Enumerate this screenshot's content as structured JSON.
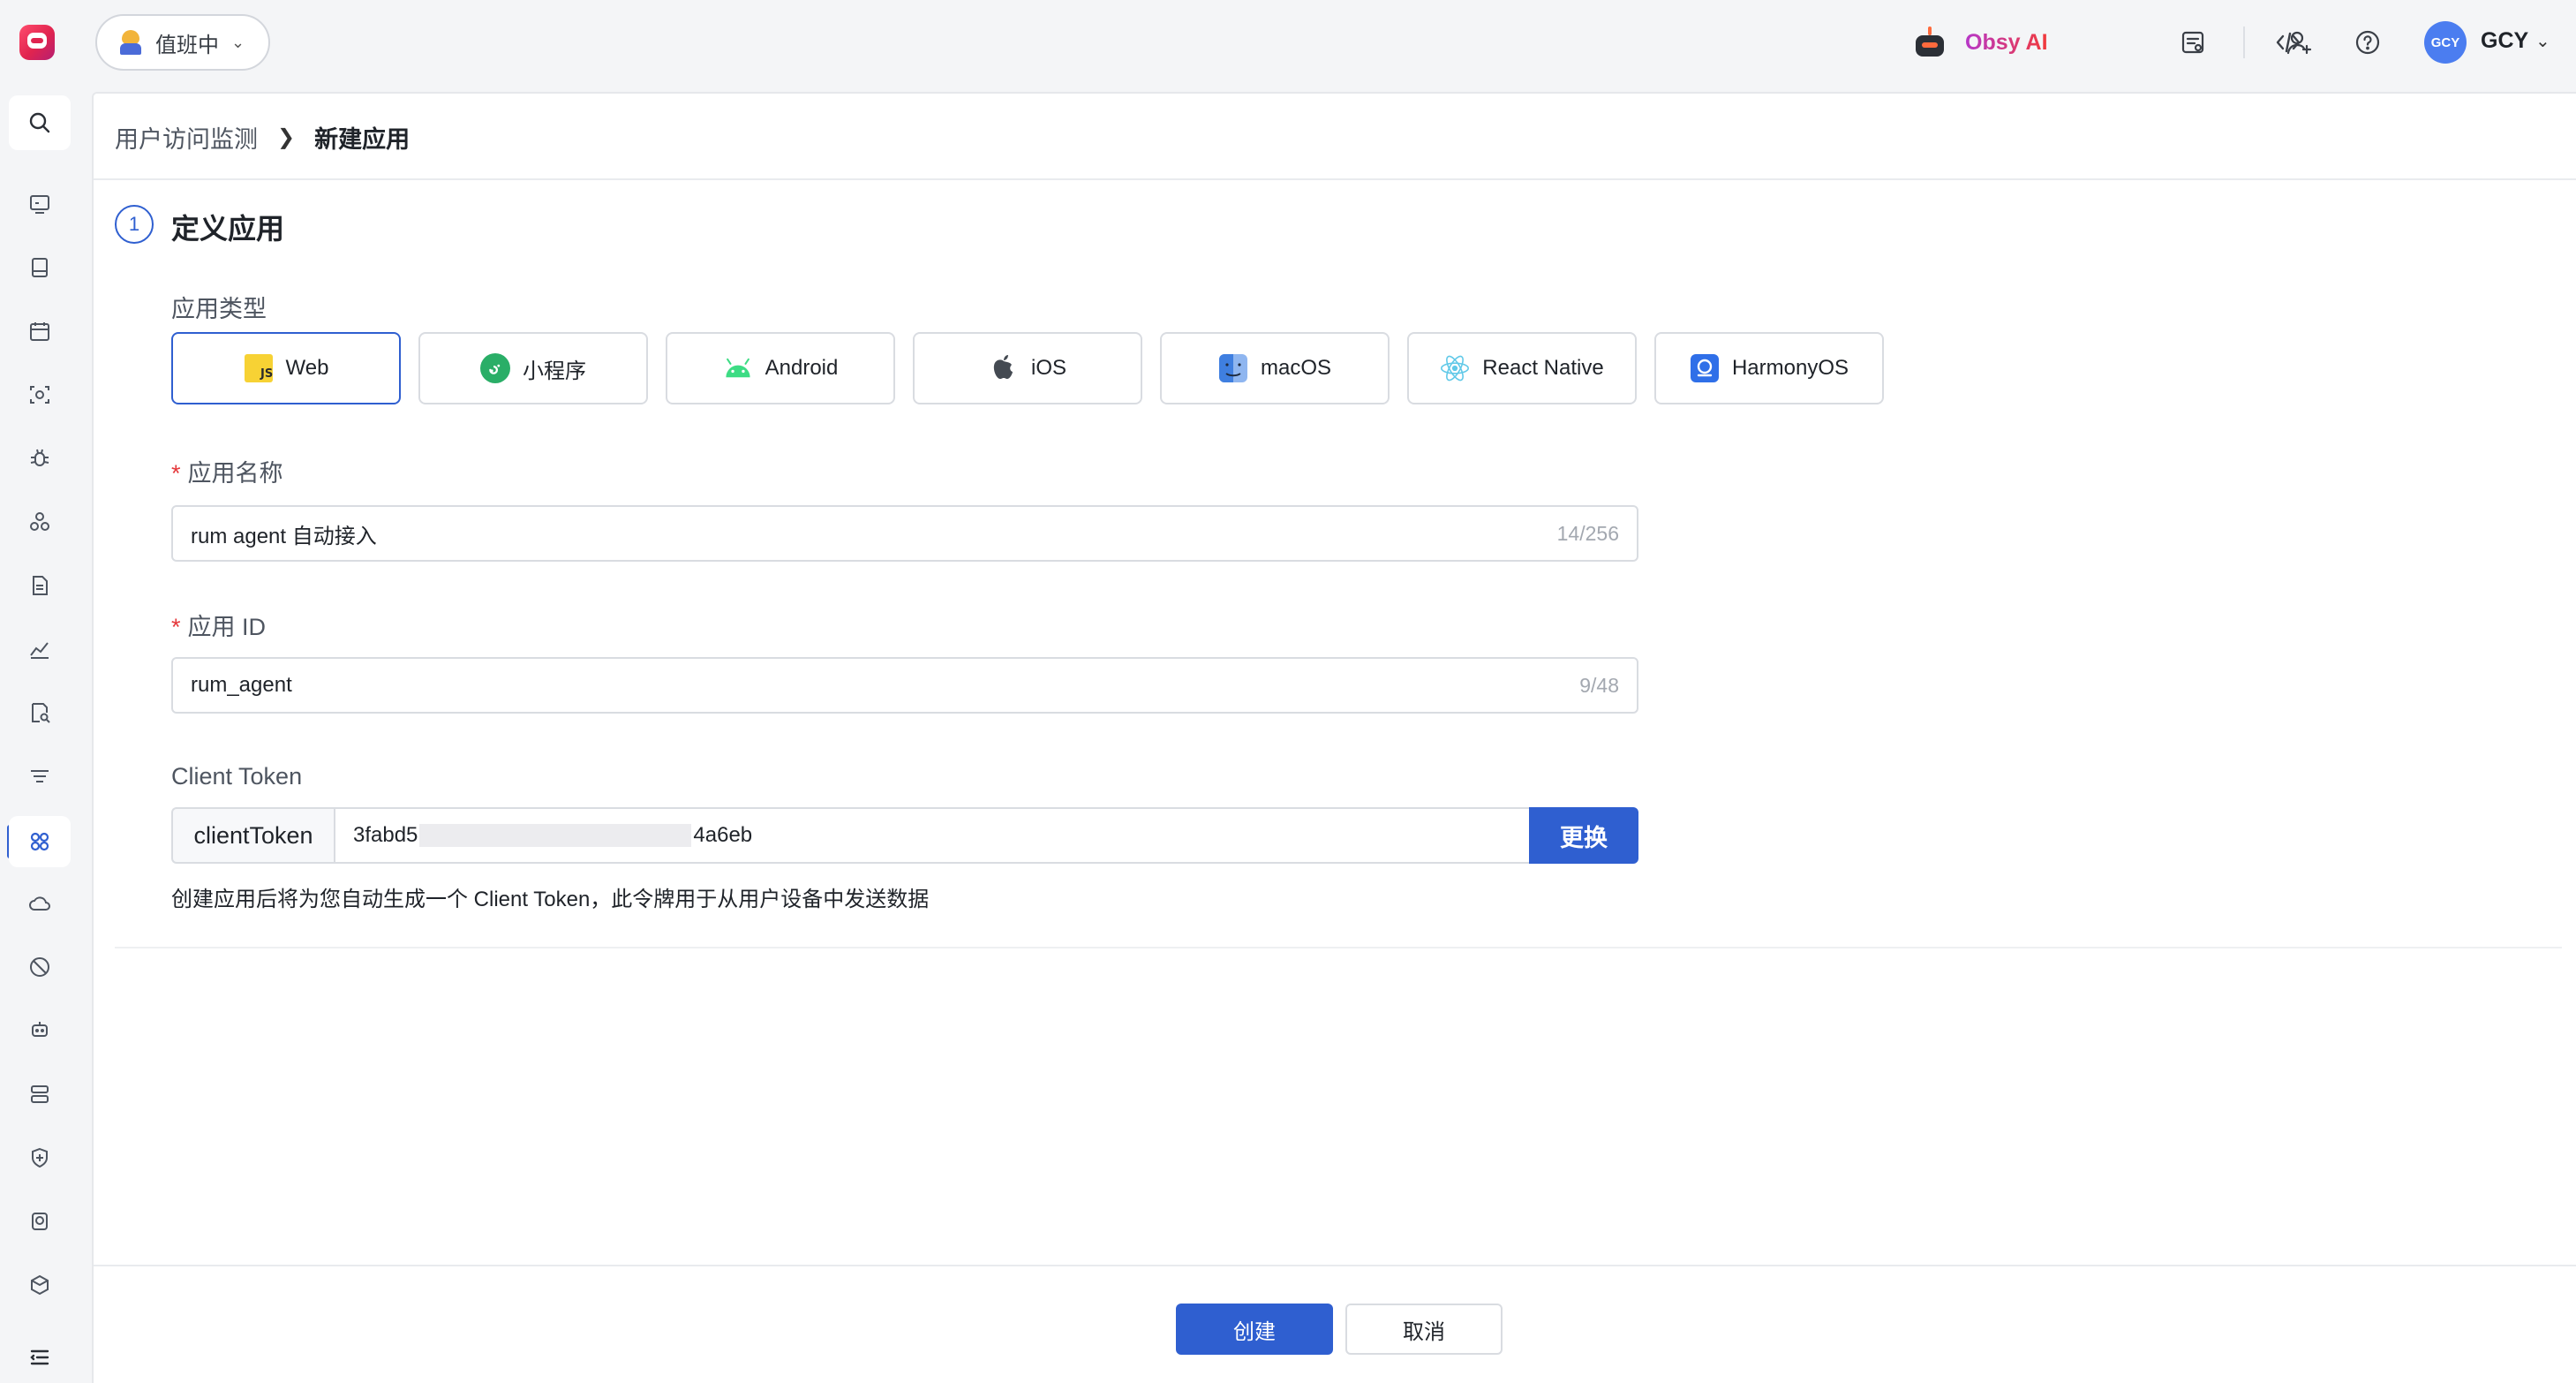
{
  "topbar": {
    "duty_status": "值班中",
    "ai_label": "Obsy AI",
    "user_initials": "GCY",
    "user_name": "GCY"
  },
  "breadcrumb": {
    "parent": "用户访问监测",
    "current": "新建应用"
  },
  "step": {
    "number": "1",
    "title": "定义应用"
  },
  "app_type": {
    "label": "应用类型",
    "options": [
      {
        "label": "Web",
        "icon": "js-icon",
        "selected": true
      },
      {
        "label": "小程序",
        "icon": "miniprogram-icon",
        "selected": false
      },
      {
        "label": "Android",
        "icon": "android-icon",
        "selected": false
      },
      {
        "label": "iOS",
        "icon": "apple-icon",
        "selected": false
      },
      {
        "label": "macOS",
        "icon": "finder-icon",
        "selected": false
      },
      {
        "label": "React Native",
        "icon": "react-icon",
        "selected": false
      },
      {
        "label": "HarmonyOS",
        "icon": "harmonyos-icon",
        "selected": false
      }
    ]
  },
  "app_name": {
    "label": "应用名称",
    "value": "rum agent 自动接入",
    "count": "14/256"
  },
  "app_id": {
    "label": "应用 ID",
    "value": "rum_agent",
    "count": "9/48"
  },
  "client_token": {
    "label": "Client Token",
    "prefix": "clientToken",
    "value_start": "3fabd5",
    "value_end": "4a6eb",
    "button": "更换",
    "hint": "创建应用后将为您自动生成一个 Client Token，此令牌用于从用户设备中发送数据"
  },
  "footer": {
    "create": "创建",
    "cancel": "取消"
  },
  "colors": {
    "accent": "#2f5fd0",
    "required": "#e5383b"
  }
}
